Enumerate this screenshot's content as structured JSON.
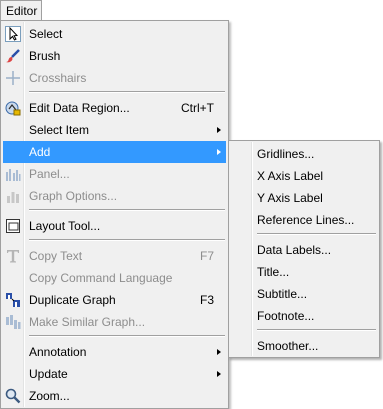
{
  "menubar": {
    "editor_label": "Editor"
  },
  "menu": {
    "select": "Select",
    "brush": "Brush",
    "crosshairs": "Crosshairs",
    "edit_data_region": "Edit Data Region...",
    "edit_data_region_shortcut": "Ctrl+T",
    "select_item": "Select Item",
    "add": "Add",
    "panel": "Panel...",
    "graph_options": "Graph Options...",
    "layout_tool": "Layout Tool...",
    "copy_text": "Copy Text",
    "copy_text_shortcut": "F7",
    "copy_command_language": "Copy Command Language",
    "duplicate_graph": "Duplicate Graph",
    "duplicate_graph_shortcut": "F3",
    "make_similar_graph": "Make Similar Graph...",
    "annotation": "Annotation",
    "update": "Update",
    "zoom": "Zoom..."
  },
  "submenu": {
    "gridlines": "Gridlines...",
    "x_axis_label": "X Axis Label",
    "y_axis_label": "Y Axis Label",
    "reference_lines": "Reference Lines...",
    "data_labels": "Data Labels...",
    "title": "Title...",
    "subtitle": "Subtitle...",
    "footnote": "Footnote...",
    "smoother": "Smoother..."
  },
  "colors": {
    "highlight": "#3399ff",
    "menu_bg": "#f0f0f0",
    "disabled_text": "#8d8d8d"
  }
}
